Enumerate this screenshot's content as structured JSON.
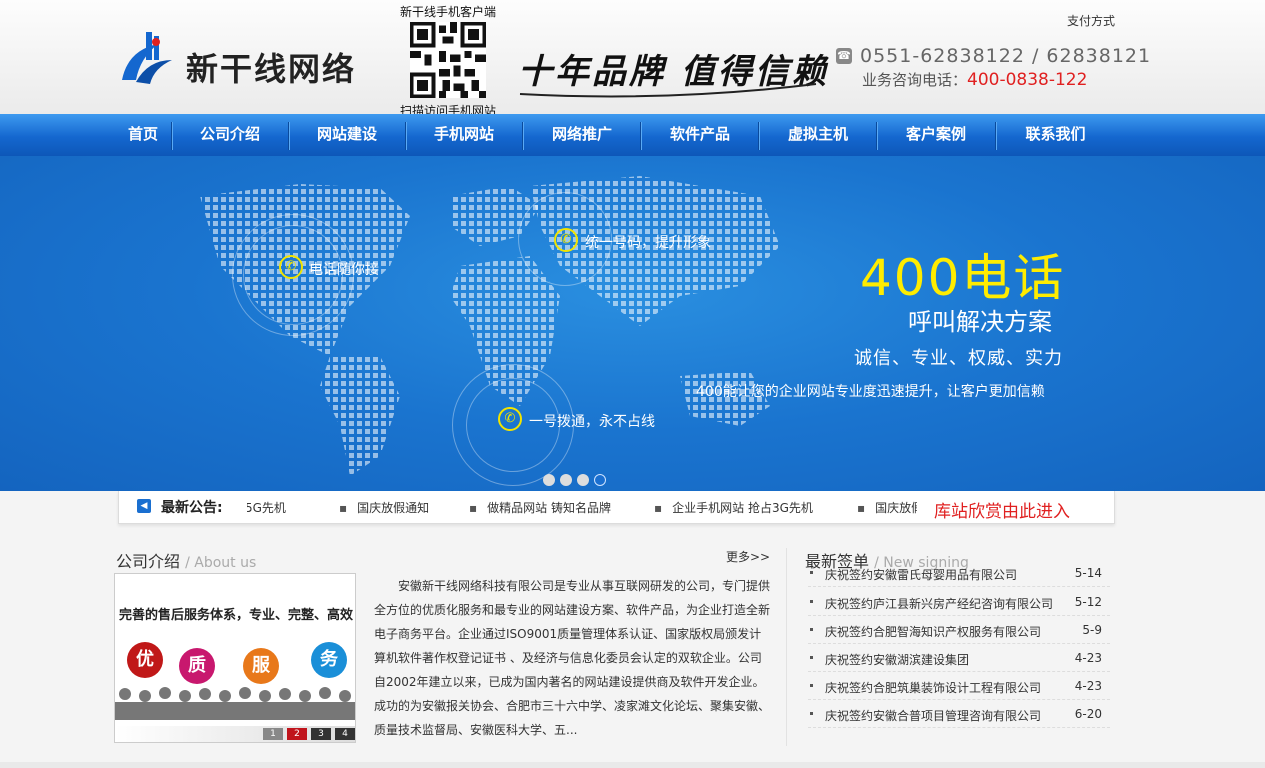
{
  "header": {
    "logo_text": "新干线网络",
    "qr_top_text": "新干线手机客户端",
    "qr_bottom_text": "扫描访问手机网站",
    "slogan": "十年品牌 值得信赖",
    "phone": "0551-62838122 / 62838121",
    "hotline_label": "业务咨询电话：",
    "hotline_number": "400-0838-122",
    "pay_link": "支付方式",
    "colors": {
      "accent": "#1467cf",
      "highlight": "#e02020"
    }
  },
  "nav": {
    "items": [
      "首页",
      "公司介绍",
      "网站建设",
      "手机网站",
      "网络推广",
      "软件产品",
      "虚拟主机",
      "客户案例",
      "联系我们"
    ]
  },
  "banner": {
    "callout1": "电话随你接",
    "callout2": "统一号码，提升形象",
    "callout3": "一号拨通，永不占线",
    "title": "400电话",
    "subtitle": "呼叫解决方案",
    "tagline": "诚信、专业、权威、实力",
    "description": "400能让您的企业网站专业度迅速提升，让客户更加信赖",
    "slide_count": 4,
    "active_slide": 4,
    "title_color": "#ffec00"
  },
  "notice": {
    "title": "最新公告:",
    "items": [
      "5G先机",
      "国庆放假通知",
      "做精品网站 铸知名品牌",
      "企业手机网站 抢占3G先机",
      "国庆放假"
    ],
    "case_link": "库站欣赏由此进入"
  },
  "about": {
    "title": "公司介绍",
    "title_en": "/ About us",
    "more": "更多>>",
    "image_heading": "完善的售后服务体系，专业、完整、高效",
    "image_chars": [
      "优",
      "质",
      "服",
      "务"
    ],
    "pager": [
      "1",
      "2",
      "3",
      "4"
    ],
    "text": "安徽新干线网络科技有限公司是专业从事互联网研发的公司，专门提供全方位的优质化服务和最专业的网站建设方案、软件产品，为企业打造全新电子商务平台。企业通过ISO9001质量管理体系认证、国家版权局颁发计算机软件著作权登记证书 、及经济与信息化委员会认定的双软企业。公司自2002年建立以来，已成为国内著名的网站建设提供商及软件开发企业。成功的为安徽报关协会、合肥市三十六中学、凌家滩文化论坛、聚集安徽、质量技术监督局、安徽医科大学、五..."
  },
  "signing": {
    "title": "最新签单",
    "title_en": "/ New signing",
    "items": [
      {
        "name": "庆祝签约安徽雷氏母婴用品有限公司",
        "date": "5-14"
      },
      {
        "name": "庆祝签约庐江县新兴房产经纪咨询有限公司",
        "date": "5-12"
      },
      {
        "name": "庆祝签约合肥智海知识产权服务有限公司",
        "date": "5-9"
      },
      {
        "name": "庆祝签约安徽湖滨建设集团",
        "date": "4-23"
      },
      {
        "name": "庆祝签约合肥筑巢装饰设计工程有限公司",
        "date": "4-23"
      },
      {
        "name": "庆祝签约安徽合普项目管理咨询有限公司",
        "date": "6-20"
      }
    ]
  }
}
